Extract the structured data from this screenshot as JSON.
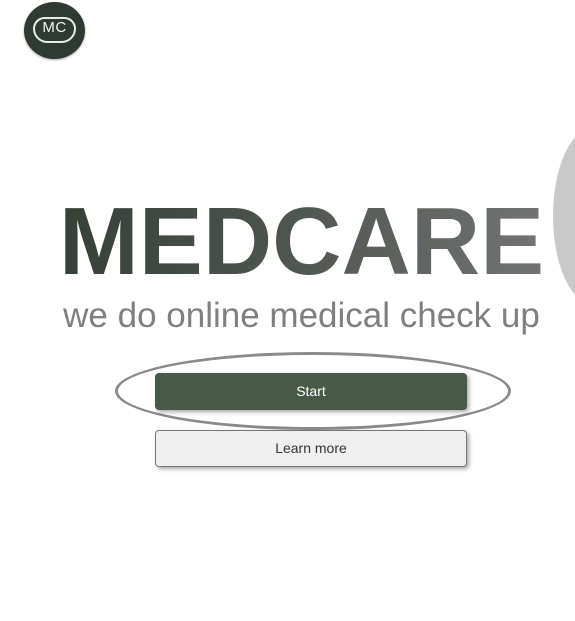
{
  "logo": {
    "text": "MC"
  },
  "hero": {
    "title": "MEDCARE",
    "subtitle": "we do online medical check up"
  },
  "actions": {
    "start_label": "Start",
    "learn_more_label": "Learn more"
  },
  "colors": {
    "brand_dark_green": "#475a48",
    "logo_background": "#2f3a32",
    "secondary_button_bg": "#efefef",
    "subtitle_gray": "#7f7f7f"
  }
}
